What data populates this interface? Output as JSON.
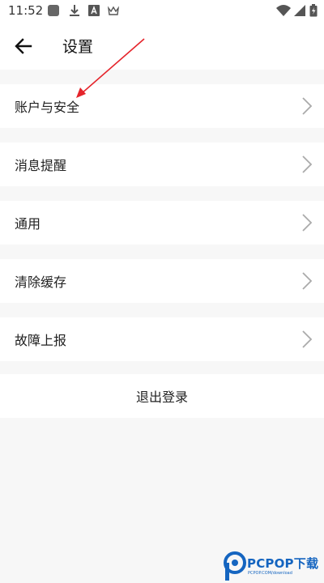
{
  "status_bar": {
    "time": "11:52",
    "icons": [
      "app-icon",
      "download-icon",
      "a-icon",
      "crown-icon",
      "wifi-icon",
      "signal-icon",
      "battery-icon"
    ]
  },
  "header": {
    "title": "设置",
    "back_icon": "back-arrow-icon"
  },
  "settings": {
    "items": [
      {
        "label": "账户与安全"
      },
      {
        "label": "消息提醒"
      },
      {
        "label": "通用"
      },
      {
        "label": "清除缓存"
      },
      {
        "label": "故障上报"
      }
    ],
    "chevron_icon": "chevron-right-icon"
  },
  "logout": {
    "label": "退出登录"
  },
  "watermark": {
    "text": "PCPOP下载",
    "sub": "PCPOP.COM/download"
  },
  "colors": {
    "accent_arrow": "#e5242b",
    "watermark": "#1565c0",
    "background": "#f7f7f7"
  }
}
